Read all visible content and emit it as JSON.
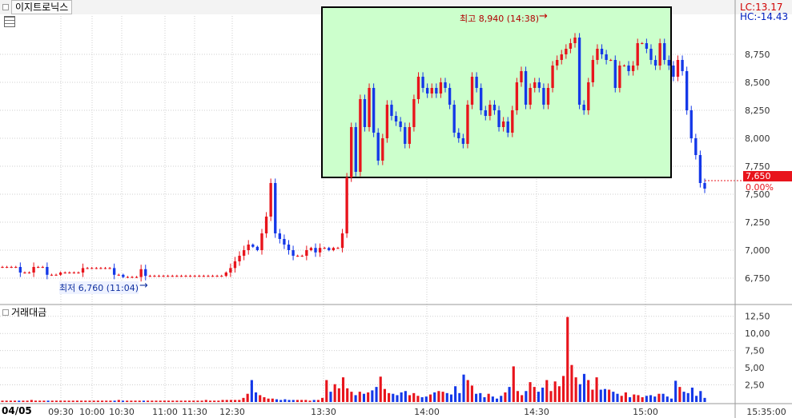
{
  "panel_title": "이지트로닉스",
  "lc_label": "LC:13.17",
  "hc_label": "HC:-14.43",
  "date_label": "04/05",
  "volume_panel_title": "거래대금",
  "current_price_label": "7,650",
  "current_change_label": "0.00%",
  "max_annotation": "최고 8,940 (14:38)",
  "min_annotation": "최저 6,760 (11:04)",
  "colors": {
    "up": "#e8141c",
    "down": "#1438e8",
    "box_fill": "#ccffcc",
    "grid": "#c8c8c8"
  },
  "chart_data": [
    {
      "type": "candlestick",
      "title": "",
      "x_ticks": [
        "09:30",
        "10:00",
        "10:30",
        "11:00",
        "11:30",
        "12:30",
        "13:30",
        "14:00",
        "14:30",
        "15:00",
        "15:35:00"
      ],
      "y_ticks": [
        "6,750",
        "7,000",
        "7,250",
        "7,500",
        "7,750",
        "8,000",
        "8,250",
        "8,500",
        "8,750"
      ],
      "ylim": [
        6650,
        8950
      ],
      "close_series": [
        6850,
        6850,
        6850,
        6850,
        6800,
        6800,
        6800,
        6850,
        6850,
        6850,
        6780,
        6780,
        6780,
        6800,
        6800,
        6800,
        6800,
        6800,
        6840,
        6840,
        6840,
        6840,
        6840,
        6840,
        6840,
        6780,
        6780,
        6760,
        6760,
        6760,
        6760,
        6830,
        6770,
        6770,
        6770,
        6770,
        6770,
        6770,
        6770,
        6770,
        6770,
        6770,
        6770,
        6770,
        6770,
        6770,
        6770,
        6770,
        6770,
        6770,
        6800,
        6840,
        6900,
        6950,
        7000,
        7050,
        7030,
        7000,
        7150,
        7300,
        7600,
        7150,
        7100,
        7050,
        7000,
        6950,
        6950,
        6950,
        7000,
        7020,
        6980,
        7020,
        7020,
        7000,
        7020,
        7020,
        7150,
        7650,
        8100,
        7700,
        8350,
        8100,
        8450,
        8050,
        7800,
        8000,
        8300,
        8200,
        8150,
        8100,
        7950,
        8100,
        8350,
        8550,
        8450,
        8400,
        8450,
        8400,
        8500,
        8450,
        8300,
        8050,
        8000,
        7950,
        8300,
        8550,
        8450,
        8250,
        8200,
        8300,
        8250,
        8100,
        8150,
        8050,
        8250,
        8500,
        8600,
        8300,
        8450,
        8500,
        8450,
        8300,
        8450,
        8650,
        8700,
        8750,
        8800,
        8850,
        8900,
        8300,
        8250,
        8500,
        8700,
        8800,
        8750,
        8700,
        8700,
        8450,
        8650,
        8650,
        8600,
        8650,
        8850,
        8850,
        8800,
        8700,
        8650,
        8850,
        8700,
        8650,
        8550,
        8700,
        8600,
        8250,
        8000,
        7850,
        7600,
        7550
      ],
      "volume": {
        "title": "거래대금",
        "y_ticks": [
          "2,50",
          "5,00",
          "7,50",
          "10,00",
          "12,50"
        ],
        "ylim": [
          0,
          13.17
        ],
        "values": [
          0.2,
          0.2,
          0.2,
          0.2,
          0.2,
          0.2,
          0.2,
          0.3,
          0.2,
          0.2,
          0.2,
          0.2,
          0.2,
          0.2,
          0.2,
          0.2,
          0.2,
          0.2,
          0.2,
          0.2,
          0.2,
          0.2,
          0.2,
          0.2,
          0.2,
          0.2,
          0.2,
          0.2,
          0.3,
          0.2,
          0.2,
          0.2,
          0.2,
          0.2,
          0.2,
          0.2,
          0.2,
          0.2,
          0.2,
          0.2,
          0.2,
          0.2,
          0.2,
          0.2,
          0.2,
          0.2,
          0.2,
          0.2,
          0.2,
          0.3,
          0.2,
          0.2,
          0.2,
          0.3,
          0.3,
          0.3,
          0.3,
          0.3,
          0.6,
          1.2,
          3.2,
          1.4,
          1.0,
          0.7,
          0.5,
          0.5,
          0.4,
          0.3,
          0.4,
          0.3,
          0.3,
          0.3,
          0.3,
          0.3,
          0.2,
          0.3,
          0.3,
          0.6,
          3.2,
          1.5,
          2.6,
          2.0,
          3.6,
          2.0,
          1.5,
          1.0,
          1.5,
          1.2,
          1.4,
          1.7,
          2.2,
          3.7,
          1.9,
          1.3,
          1.2,
          1.0,
          1.4,
          1.6,
          1.0,
          1.3,
          0.9,
          0.7,
          0.8,
          1.1,
          1.4,
          1.6,
          1.5,
          1.3,
          1.1,
          2.3,
          1.3,
          4.0,
          3.2,
          2.4,
          1.2,
          1.3,
          0.7,
          1.2,
          0.8,
          0.5,
          0.9,
          1.4,
          2.2,
          5.2,
          1.6,
          1.0,
          1.6,
          2.9,
          2.2,
          1.5,
          2.1,
          3.2,
          1.6,
          3.0,
          2.3,
          3.8,
          12.4,
          5.4,
          3.6,
          2.6,
          4.1,
          3.2,
          1.8,
          3.6,
          1.8,
          1.9,
          1.8,
          1.5,
          1.2,
          0.9,
          1.4,
          0.7,
          1.1,
          1.0,
          0.7,
          0.9,
          1.0,
          0.8,
          1.2,
          1.2,
          0.8,
          0.5,
          3.1,
          2.2,
          1.5,
          1.3,
          2.1,
          0.9,
          1.6,
          0.6
        ]
      }
    }
  ]
}
